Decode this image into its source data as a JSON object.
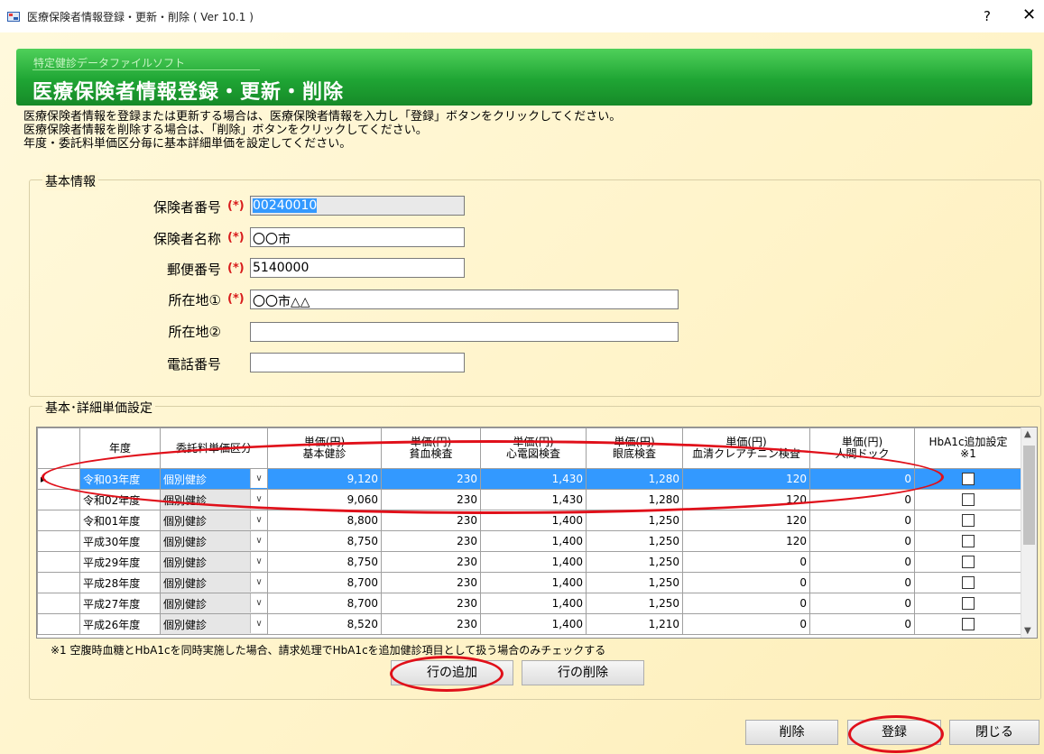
{
  "window": {
    "title": "医療保険者情報登録・更新・削除 ( Ver 10.1 )",
    "help": "?",
    "close": "✕"
  },
  "banner": {
    "subtitle": "特定健診データファイルソフト",
    "title": "医療保険者情報登録・更新・削除"
  },
  "instructions": [
    "医療保険者情報を登録または更新する場合は、医療保険者情報を入力し「登録」ボタンをクリックしてください。",
    "医療保険者情報を削除する場合は、「削除」ボタンをクリックしてください。",
    "年度・委託料単価区分毎に基本詳細単価を設定してください。"
  ],
  "basic": {
    "group_title": "基本情報",
    "required_mark": "(*)",
    "insurer_no": {
      "label": "保険者番号",
      "value": "00240010"
    },
    "insurer_name": {
      "label": "保険者名称",
      "value": "〇〇市"
    },
    "postal": {
      "label": "郵便番号",
      "value": "5140000"
    },
    "address1": {
      "label": "所在地①",
      "value": "〇〇市△△"
    },
    "address2": {
      "label": "所在地②",
      "value": ""
    },
    "phone": {
      "label": "電話番号",
      "value": ""
    }
  },
  "pricing": {
    "group_title": "基本･詳細単価設定",
    "headers": [
      "年度",
      "委託料単価区分",
      "単価(円)\n基本健診",
      "単価(円)\n貧血検査",
      "単価(円)\n心電図検査",
      "単価(円)\n眼底検査",
      "単価(円)\n血清クレアチニン検査",
      "単価(円)\n人間ドック",
      "HbA1c追加設定\n※1"
    ],
    "rows": [
      {
        "year": "令和03年度",
        "category": "個別健診",
        "basic": "9,120",
        "anemia": "230",
        "ecg": "1,430",
        "fundus": "1,280",
        "creatinine": "120",
        "dock": "0",
        "selected": true
      },
      {
        "year": "令和02年度",
        "category": "個別健診",
        "basic": "9,060",
        "anemia": "230",
        "ecg": "1,430",
        "fundus": "1,280",
        "creatinine": "120",
        "dock": "0",
        "selected": false
      },
      {
        "year": "令和01年度",
        "category": "個別健診",
        "basic": "8,800",
        "anemia": "230",
        "ecg": "1,400",
        "fundus": "1,250",
        "creatinine": "120",
        "dock": "0",
        "selected": false
      },
      {
        "year": "平成30年度",
        "category": "個別健診",
        "basic": "8,750",
        "anemia": "230",
        "ecg": "1,400",
        "fundus": "1,250",
        "creatinine": "120",
        "dock": "0",
        "selected": false
      },
      {
        "year": "平成29年度",
        "category": "個別健診",
        "basic": "8,750",
        "anemia": "230",
        "ecg": "1,400",
        "fundus": "1,250",
        "creatinine": "0",
        "dock": "0",
        "selected": false
      },
      {
        "year": "平成28年度",
        "category": "個別健診",
        "basic": "8,700",
        "anemia": "230",
        "ecg": "1,400",
        "fundus": "1,250",
        "creatinine": "0",
        "dock": "0",
        "selected": false
      },
      {
        "year": "平成27年度",
        "category": "個別健診",
        "basic": "8,700",
        "anemia": "230",
        "ecg": "1,400",
        "fundus": "1,250",
        "creatinine": "0",
        "dock": "0",
        "selected": false
      },
      {
        "year": "平成26年度",
        "category": "個別健診",
        "basic": "8,520",
        "anemia": "230",
        "ecg": "1,400",
        "fundus": "1,210",
        "creatinine": "0",
        "dock": "0",
        "selected": false
      }
    ],
    "footnote": "※1 空腹時血糖とHbA1cを同時実施した場合、請求処理でHbA1cを追加健診項目として扱う場合のみチェックする",
    "add_row": "行の追加",
    "delete_row": "行の削除"
  },
  "buttons": {
    "delete": "削除",
    "register": "登録",
    "close": "閉じる"
  },
  "colors": {
    "annotation": "#e0101a",
    "selection": "#3399ff",
    "banner": "#1fa534"
  }
}
